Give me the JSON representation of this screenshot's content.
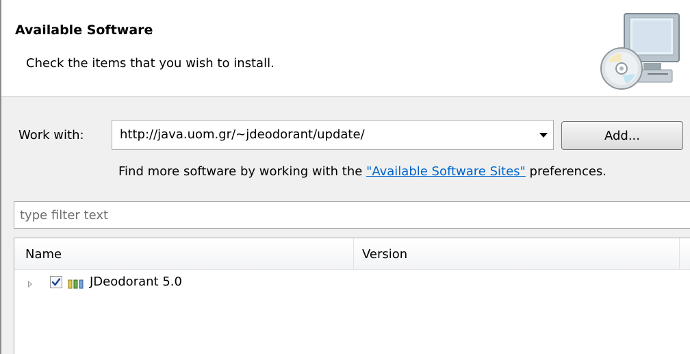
{
  "banner": {
    "title": "Available Software",
    "subtitle": "Check the items that you wish to install."
  },
  "work_with": {
    "label": "Work with:",
    "value": "http://java.uom.gr/~jdeodorant/update/",
    "add_button_label": "Add..."
  },
  "find_more": {
    "prefix": "Find more software by working with the ",
    "link_text": "\"Available Software Sites\"",
    "suffix": " preferences."
  },
  "filter": {
    "placeholder": "type filter text"
  },
  "tree": {
    "columns": [
      "Name",
      "Version"
    ],
    "rows": [
      {
        "label": "JDeodorant 5.0",
        "version": "",
        "checked": true
      }
    ]
  },
  "icons": {
    "banner": "install-computer-cd-icon",
    "expander": "tree-expand-arrow-icon",
    "feature": "feature-group-icon",
    "dropdown": "dropdown-arrow-icon"
  }
}
